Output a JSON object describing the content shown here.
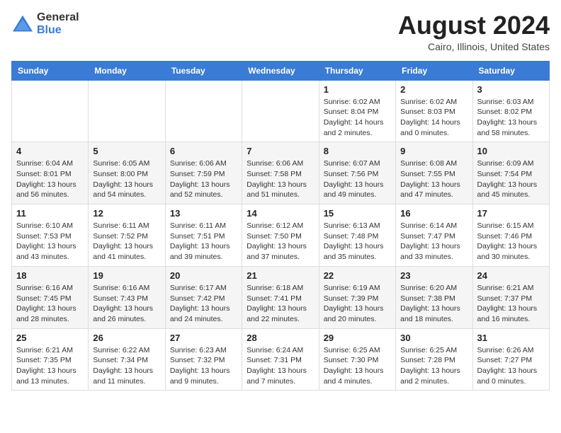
{
  "header": {
    "logo_general": "General",
    "logo_blue": "Blue",
    "month_year": "August 2024",
    "location": "Cairo, Illinois, United States"
  },
  "days_of_week": [
    "Sunday",
    "Monday",
    "Tuesday",
    "Wednesday",
    "Thursday",
    "Friday",
    "Saturday"
  ],
  "weeks": [
    [
      {
        "day": "",
        "info": ""
      },
      {
        "day": "",
        "info": ""
      },
      {
        "day": "",
        "info": ""
      },
      {
        "day": "",
        "info": ""
      },
      {
        "day": "1",
        "info": "Sunrise: 6:02 AM\nSunset: 8:04 PM\nDaylight: 14 hours\nand 2 minutes."
      },
      {
        "day": "2",
        "info": "Sunrise: 6:02 AM\nSunset: 8:03 PM\nDaylight: 14 hours\nand 0 minutes."
      },
      {
        "day": "3",
        "info": "Sunrise: 6:03 AM\nSunset: 8:02 PM\nDaylight: 13 hours\nand 58 minutes."
      }
    ],
    [
      {
        "day": "4",
        "info": "Sunrise: 6:04 AM\nSunset: 8:01 PM\nDaylight: 13 hours\nand 56 minutes."
      },
      {
        "day": "5",
        "info": "Sunrise: 6:05 AM\nSunset: 8:00 PM\nDaylight: 13 hours\nand 54 minutes."
      },
      {
        "day": "6",
        "info": "Sunrise: 6:06 AM\nSunset: 7:59 PM\nDaylight: 13 hours\nand 52 minutes."
      },
      {
        "day": "7",
        "info": "Sunrise: 6:06 AM\nSunset: 7:58 PM\nDaylight: 13 hours\nand 51 minutes."
      },
      {
        "day": "8",
        "info": "Sunrise: 6:07 AM\nSunset: 7:56 PM\nDaylight: 13 hours\nand 49 minutes."
      },
      {
        "day": "9",
        "info": "Sunrise: 6:08 AM\nSunset: 7:55 PM\nDaylight: 13 hours\nand 47 minutes."
      },
      {
        "day": "10",
        "info": "Sunrise: 6:09 AM\nSunset: 7:54 PM\nDaylight: 13 hours\nand 45 minutes."
      }
    ],
    [
      {
        "day": "11",
        "info": "Sunrise: 6:10 AM\nSunset: 7:53 PM\nDaylight: 13 hours\nand 43 minutes."
      },
      {
        "day": "12",
        "info": "Sunrise: 6:11 AM\nSunset: 7:52 PM\nDaylight: 13 hours\nand 41 minutes."
      },
      {
        "day": "13",
        "info": "Sunrise: 6:11 AM\nSunset: 7:51 PM\nDaylight: 13 hours\nand 39 minutes."
      },
      {
        "day": "14",
        "info": "Sunrise: 6:12 AM\nSunset: 7:50 PM\nDaylight: 13 hours\nand 37 minutes."
      },
      {
        "day": "15",
        "info": "Sunrise: 6:13 AM\nSunset: 7:48 PM\nDaylight: 13 hours\nand 35 minutes."
      },
      {
        "day": "16",
        "info": "Sunrise: 6:14 AM\nSunset: 7:47 PM\nDaylight: 13 hours\nand 33 minutes."
      },
      {
        "day": "17",
        "info": "Sunrise: 6:15 AM\nSunset: 7:46 PM\nDaylight: 13 hours\nand 30 minutes."
      }
    ],
    [
      {
        "day": "18",
        "info": "Sunrise: 6:16 AM\nSunset: 7:45 PM\nDaylight: 13 hours\nand 28 minutes."
      },
      {
        "day": "19",
        "info": "Sunrise: 6:16 AM\nSunset: 7:43 PM\nDaylight: 13 hours\nand 26 minutes."
      },
      {
        "day": "20",
        "info": "Sunrise: 6:17 AM\nSunset: 7:42 PM\nDaylight: 13 hours\nand 24 minutes."
      },
      {
        "day": "21",
        "info": "Sunrise: 6:18 AM\nSunset: 7:41 PM\nDaylight: 13 hours\nand 22 minutes."
      },
      {
        "day": "22",
        "info": "Sunrise: 6:19 AM\nSunset: 7:39 PM\nDaylight: 13 hours\nand 20 minutes."
      },
      {
        "day": "23",
        "info": "Sunrise: 6:20 AM\nSunset: 7:38 PM\nDaylight: 13 hours\nand 18 minutes."
      },
      {
        "day": "24",
        "info": "Sunrise: 6:21 AM\nSunset: 7:37 PM\nDaylight: 13 hours\nand 16 minutes."
      }
    ],
    [
      {
        "day": "25",
        "info": "Sunrise: 6:21 AM\nSunset: 7:35 PM\nDaylight: 13 hours\nand 13 minutes."
      },
      {
        "day": "26",
        "info": "Sunrise: 6:22 AM\nSunset: 7:34 PM\nDaylight: 13 hours\nand 11 minutes."
      },
      {
        "day": "27",
        "info": "Sunrise: 6:23 AM\nSunset: 7:32 PM\nDaylight: 13 hours\nand 9 minutes."
      },
      {
        "day": "28",
        "info": "Sunrise: 6:24 AM\nSunset: 7:31 PM\nDaylight: 13 hours\nand 7 minutes."
      },
      {
        "day": "29",
        "info": "Sunrise: 6:25 AM\nSunset: 7:30 PM\nDaylight: 13 hours\nand 4 minutes."
      },
      {
        "day": "30",
        "info": "Sunrise: 6:25 AM\nSunset: 7:28 PM\nDaylight: 13 hours\nand 2 minutes."
      },
      {
        "day": "31",
        "info": "Sunrise: 6:26 AM\nSunset: 7:27 PM\nDaylight: 13 hours\nand 0 minutes."
      }
    ]
  ]
}
